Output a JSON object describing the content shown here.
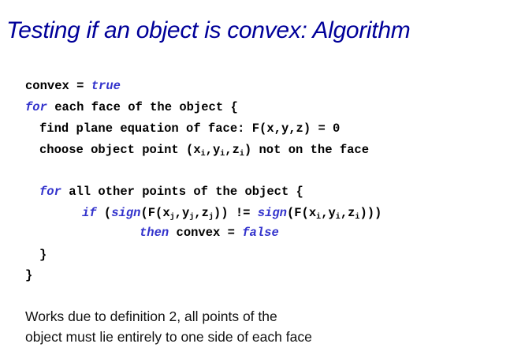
{
  "title": "Testing if an object is convex: Algorithm",
  "code": {
    "l1": {
      "a": "convex = ",
      "kw": "true"
    },
    "l2": {
      "kw": "for",
      "a": " each face of the object {"
    },
    "l3": {
      "a": "find plane equation of face: F(x,y,z) = 0"
    },
    "l4": {
      "a": "choose object point (x",
      "s1": "i",
      "b": ",y",
      "s2": "i",
      "c": ",z",
      "s3": "i",
      "d": ") not on the face"
    },
    "l5": {
      "kw": "for",
      "a": " all other points of the object {"
    },
    "l6": {
      "kw1": "if",
      "a": " (",
      "kw2": "sign",
      "b": "(F(x",
      "s1": "j",
      "c": ",y",
      "s2": "j",
      "d": ",z",
      "s3": "j",
      "e": ")) != ",
      "kw3": "sign",
      "f": "(F(x",
      "s4": "i",
      "g": ",y",
      "s5": "i",
      "h": ",z",
      "s6": "i",
      "k": ")))"
    },
    "l7": {
      "kw1": "then",
      "a": " convex = ",
      "kw2": "false"
    },
    "l8": {
      "a": "}"
    },
    "l9": {
      "a": "}"
    }
  },
  "note": {
    "line1": "Works due to definition 2, all points of the",
    "line2": "object must lie entirely to one side of each face"
  }
}
